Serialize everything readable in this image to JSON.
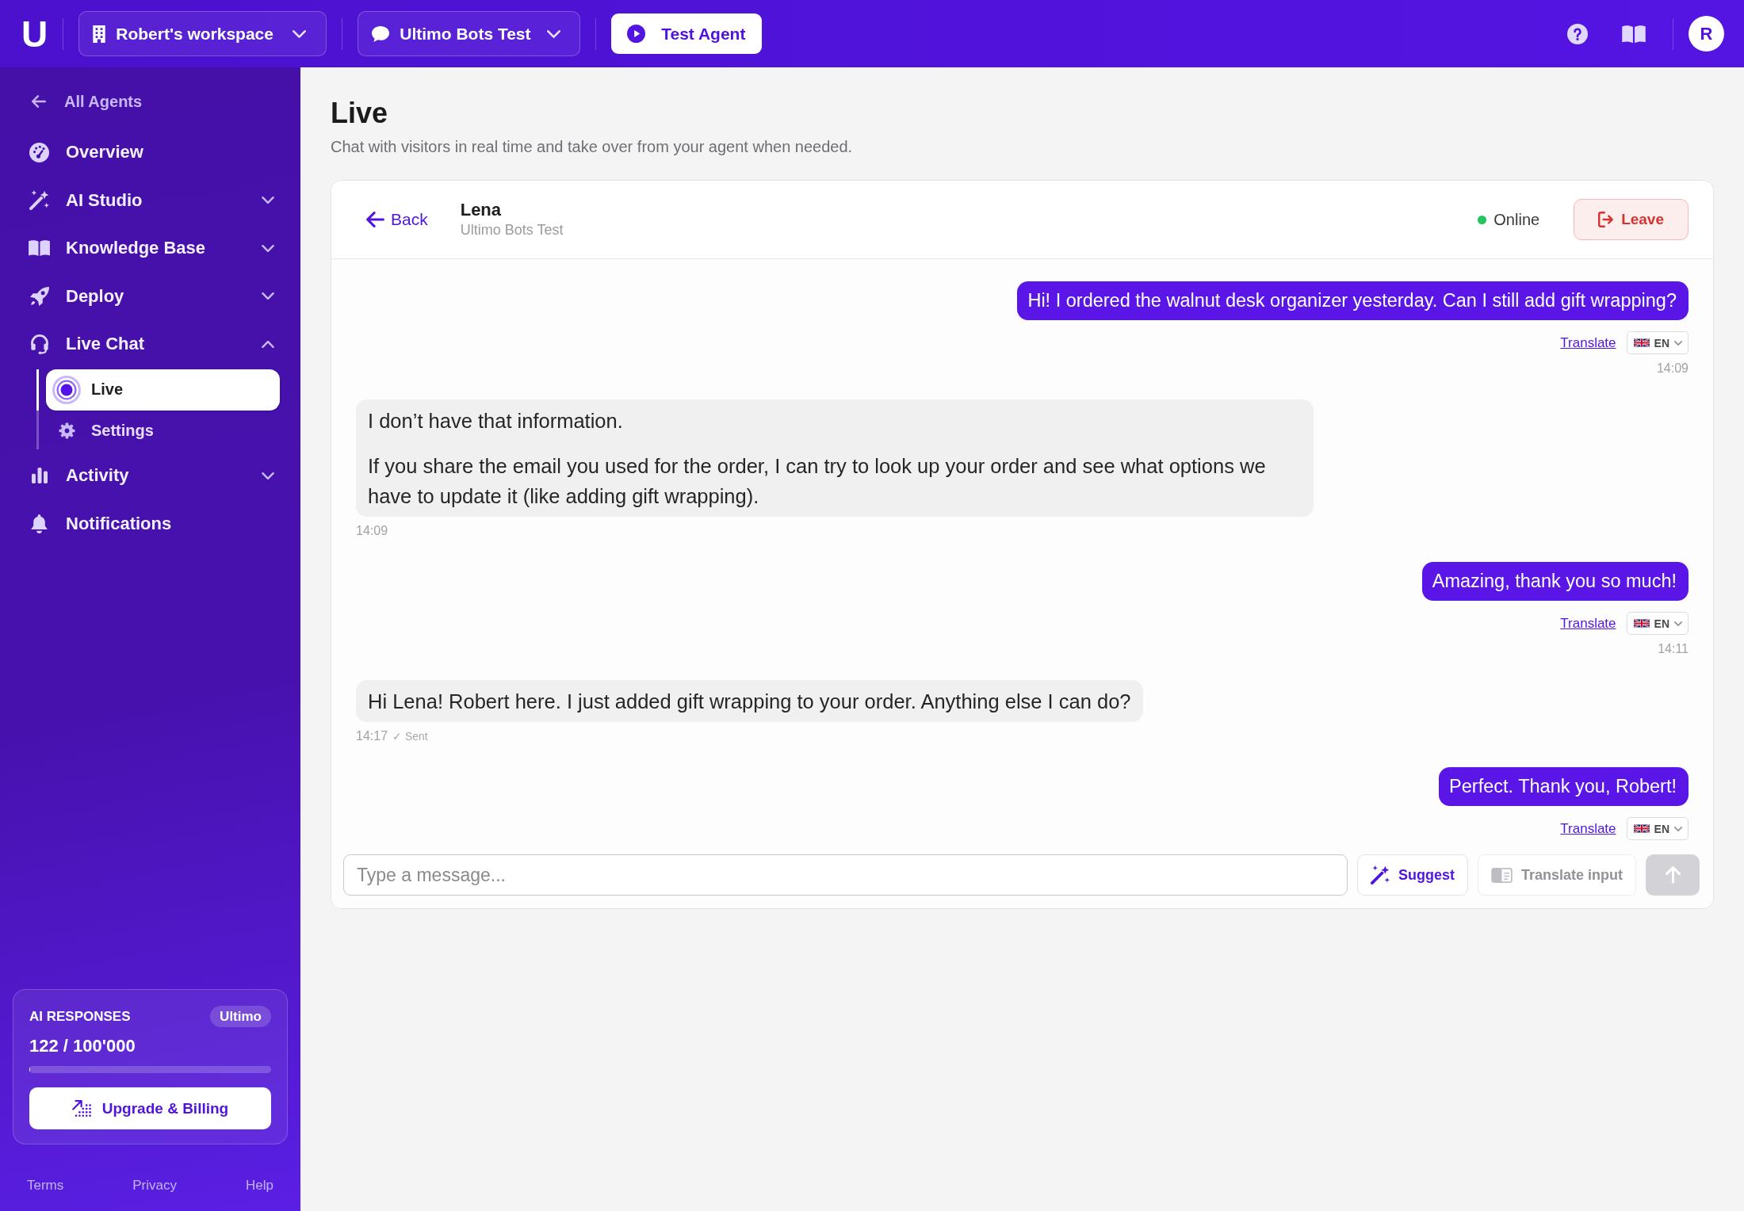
{
  "topbar": {
    "logo": "U",
    "workspace_selector": "Robert's workspace",
    "agent_selector": "Ultimo Bots Test",
    "test_button": "Test Agent",
    "avatar": "R"
  },
  "sidebar": {
    "back_link": "All Agents",
    "items": [
      {
        "label": "Overview",
        "selected": false
      },
      {
        "label": "AI Studio",
        "selected": false,
        "expanded": false
      },
      {
        "label": "Knowledge Base",
        "selected": false,
        "expanded": false
      },
      {
        "label": "Deploy",
        "selected": false,
        "expanded": false
      },
      {
        "label": "Live Chat",
        "selected": false,
        "expanded": true,
        "children": [
          {
            "label": "Live",
            "selected": true
          },
          {
            "label": "Settings",
            "selected": false
          }
        ]
      },
      {
        "label": "Activity",
        "selected": false,
        "expanded": false
      },
      {
        "label": "Notifications",
        "selected": false
      }
    ],
    "usage": {
      "title": "AI RESPONSES",
      "plan": "Ultimo",
      "count": "122 / 100'000",
      "level": 0.00122,
      "button": "Upgrade & Billing"
    },
    "footer_links": [
      "Terms",
      "Privacy",
      "Help"
    ]
  },
  "page": {
    "title": "Live",
    "subtitle": "Chat with visitors in real time and take over from your agent when needed."
  },
  "chat": {
    "back": "Back",
    "contact": {
      "name": "Lena",
      "subtitle": "Ultimo Bots Test"
    },
    "status": {
      "label": "Online",
      "online": true
    },
    "leave": "Leave",
    "messages": [
      {
        "kind": "visitor",
        "paragraphs": [
          "Hi! I ordered the walnut desk organizer yesterday. Can I still add gift wrapping?"
        ],
        "translate": "Translate",
        "language": "EN",
        "time": "14:09"
      },
      {
        "kind": "agent",
        "paragraphs": [
          "I don’t have that information.",
          "If you share the email you used for the order, I can try to look up your order and see what options we have to update it (like adding gift wrapping)."
        ],
        "time": "14:09"
      },
      {
        "kind": "visitor",
        "paragraphs": [
          "Amazing, thank you so much!"
        ],
        "translate": "Translate",
        "language": "EN",
        "time": "14:11"
      },
      {
        "kind": "agent",
        "paragraphs": [
          "Hi Lena! Robert here. I just added gift wrapping to your order. Anything else I can do?"
        ],
        "time": "14:17",
        "delivery": "✓ Sent"
      },
      {
        "kind": "visitor",
        "paragraphs": [
          "Perfect. Thank you, Robert!"
        ],
        "translate": "Translate",
        "language": "EN"
      }
    ],
    "composer": {
      "placeholder": "Type a message...",
      "buttons": [
        {
          "kind": "suggest",
          "label": "Suggest",
          "disabled": false
        },
        {
          "kind": "translate",
          "label": "Translate input",
          "disabled": true
        },
        {
          "kind": "send",
          "disabled": true
        }
      ]
    }
  }
}
